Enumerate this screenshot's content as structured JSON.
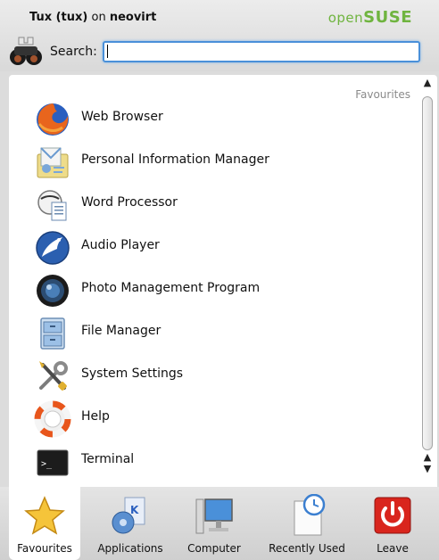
{
  "header": {
    "user_name": "Tux (tux)",
    "on_text": "on",
    "host": "neovirt",
    "brand_prefix": "open",
    "brand_suffix": "SUSE"
  },
  "search": {
    "label": "Search:",
    "value": "",
    "placeholder": ""
  },
  "panel": {
    "section_label": "Favourites",
    "items": [
      {
        "label": "Web Browser",
        "icon": "firefox-icon"
      },
      {
        "label": "Personal Information Manager",
        "icon": "pim-icon"
      },
      {
        "label": "Word Processor",
        "icon": "word-processor-icon"
      },
      {
        "label": "Audio Player",
        "icon": "audio-player-icon"
      },
      {
        "label": "Photo Management Program",
        "icon": "photo-icon"
      },
      {
        "label": "File Manager",
        "icon": "file-manager-icon"
      },
      {
        "label": "System Settings",
        "icon": "settings-icon"
      },
      {
        "label": "Help",
        "icon": "help-icon"
      },
      {
        "label": "Terminal",
        "icon": "terminal-icon"
      }
    ]
  },
  "tabs": [
    {
      "label": "Favourites",
      "active": true
    },
    {
      "label": "Applications",
      "active": false
    },
    {
      "label": "Computer",
      "active": false
    },
    {
      "label": "Recently Used",
      "active": false
    },
    {
      "label": "Leave",
      "active": false
    }
  ],
  "colors": {
    "brand_green": "#6fb43f",
    "focus_blue": "#4a90d9",
    "leave_red": "#d9251d"
  }
}
